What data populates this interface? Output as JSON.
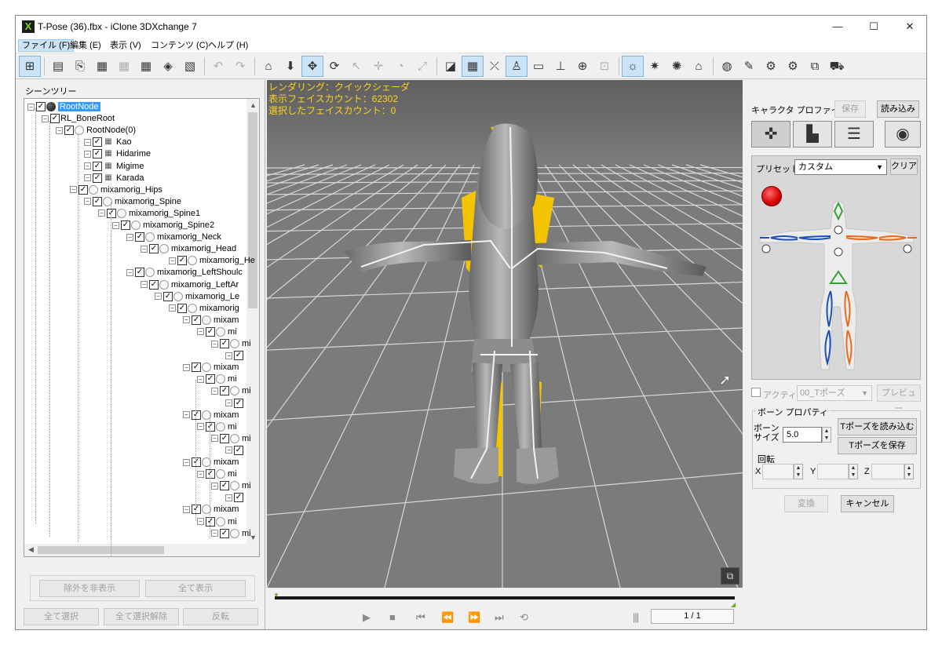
{
  "window": {
    "title": "T-Pose (36).fbx - iClone 3DXchange 7",
    "minimize": "—",
    "maximize": "☐",
    "close": "✕"
  },
  "menu": [
    {
      "label": "ファイル (F)",
      "active": true
    },
    {
      "label": "編集 (E)"
    },
    {
      "label": "表示 (V)"
    },
    {
      "label": "コンテンツ (C)"
    },
    {
      "label": "ヘルプ (H)"
    }
  ],
  "toolbar": {
    "icons": [
      "scene-tree-icon",
      "open-icon",
      "import-icon",
      "export-fbx-icon",
      "export-bvh-icon",
      "export-obj-icon",
      "convert-icon",
      "export-image-icon",
      "undo-icon",
      "redo-icon",
      "home-view-icon",
      "down-arrow-icon",
      "move-icon",
      "rotate-view-icon",
      "pick-icon",
      "pan-icon",
      "orbit-icon",
      "zoom-icon",
      "box-icon",
      "grid-icon",
      "axis-icon",
      "character-icon",
      "monitor-icon",
      "stand-icon",
      "sphere-grid-icon",
      "target-icon",
      "light-icon",
      "sun-icon",
      "ambient-icon",
      "museum-icon",
      "globe-icon",
      "wrench-icon",
      "gear-character-icon",
      "gear-prop-icon",
      "copy-icon",
      "cart-icon"
    ]
  },
  "scene_tree": {
    "label": "シーンツリー",
    "rows": [
      {
        "text": "RootNode",
        "icon": "root",
        "selected": true
      },
      {
        "text": "RL_BoneRoot",
        "icon": "none"
      },
      {
        "text": "RootNode(0)",
        "icon": "bone"
      },
      {
        "text": "Kao",
        "icon": "mesh"
      },
      {
        "text": "Hidarime",
        "icon": "mesh"
      },
      {
        "text": "Migime",
        "icon": "mesh"
      },
      {
        "text": "Karada",
        "icon": "mesh"
      },
      {
        "text": "mixamorig_Hips",
        "icon": "bone"
      },
      {
        "text": "mixamorig_Spine",
        "icon": "bone"
      },
      {
        "text": "mixamorig_Spine1",
        "icon": "bone"
      },
      {
        "text": "mixamorig_Spine2",
        "icon": "bone"
      },
      {
        "text": "mixamorig_Neck",
        "icon": "bone"
      },
      {
        "text": "mixamorig_Head",
        "icon": "bone"
      },
      {
        "text": "mixamorig_He",
        "icon": "bone"
      },
      {
        "text": "mixamorig_LeftShoulc",
        "icon": "bone"
      },
      {
        "text": "mixamorig_LeftAr",
        "icon": "bone"
      },
      {
        "text": "mixamorig_Le",
        "icon": "bone"
      },
      {
        "text": "mixamorig",
        "icon": "bone"
      },
      {
        "text": "mixam",
        "icon": "bone"
      },
      {
        "text": "mi",
        "icon": "bone"
      },
      {
        "text": "mi",
        "icon": "bone"
      },
      {
        "text": "",
        "icon": "none"
      },
      {
        "text": "mixam",
        "icon": "bone"
      },
      {
        "text": "mi",
        "icon": "bone"
      },
      {
        "text": "mi",
        "icon": "bone"
      },
      {
        "text": "",
        "icon": "none"
      },
      {
        "text": "mixam",
        "icon": "bone"
      },
      {
        "text": "mi",
        "icon": "bone"
      },
      {
        "text": "mi",
        "icon": "bone"
      },
      {
        "text": "",
        "icon": "none"
      },
      {
        "text": "mixam",
        "icon": "bone"
      },
      {
        "text": "mi",
        "icon": "bone"
      },
      {
        "text": "mi",
        "icon": "bone"
      },
      {
        "text": "",
        "icon": "none"
      },
      {
        "text": "mixam",
        "icon": "bone"
      },
      {
        "text": "mi",
        "icon": "bone"
      },
      {
        "text": "mi",
        "icon": "bone"
      }
    ],
    "buttons": {
      "hide_excluded": "除外を非表示",
      "show_all": "全て表示",
      "select_all": "全て選択",
      "deselect_all": "全て選択解除",
      "invert": "反転"
    }
  },
  "viewport": {
    "info": {
      "rendering": "レンダリング：クイックシェーダ",
      "face_count": "表示フェイスカウント：62302",
      "selected_faces": "選択したフェイスカウント：0"
    },
    "restore_icon": "restore-view-icon"
  },
  "timeline": {
    "frame": "1 / 1",
    "progress": 0
  },
  "character_profile": {
    "title": "キャラクタ プロファイル",
    "save": "保存",
    "load": "読み込み",
    "preset_label": "プリセット:",
    "preset_value": "カスタム",
    "clear": "クリア",
    "active_label": "アクティブ",
    "motion_value": "00_Tポーズ",
    "preview": "プレビュー",
    "bone_props_title": "ボーン プロパティ",
    "bone_size_label": "ボーン\nサイズ",
    "bone_size_value": "5.0",
    "load_tpose": "Tポーズを読み込む",
    "save_tpose": "Tポーズを保存",
    "rotation_label": "回転",
    "x_label": "X",
    "y_label": "Y",
    "z_label": "Z",
    "convert": "変換",
    "cancel": "キャンセル",
    "colors": {
      "left": "#1e4fb4",
      "right": "#e86a1e",
      "spine": "#3aa13a",
      "selected": "#d40000"
    }
  }
}
